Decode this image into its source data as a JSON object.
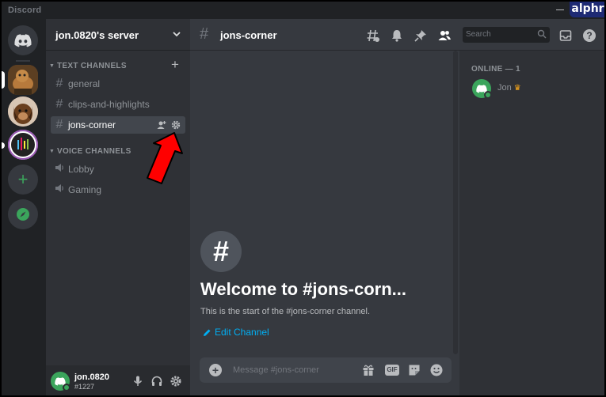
{
  "window": {
    "app_name": "Discord"
  },
  "watermark": "alphr",
  "server": {
    "name": "jon.0820's server"
  },
  "categories": {
    "text": "TEXT CHANNELS",
    "voice": "VOICE CHANNELS"
  },
  "text_channels": [
    {
      "name": "general"
    },
    {
      "name": "clips-and-highlights"
    },
    {
      "name": "jons-corner",
      "active": true
    }
  ],
  "voice_channels": [
    {
      "name": "Lobby"
    },
    {
      "name": "Gaming"
    }
  ],
  "user": {
    "name": "jon.0820",
    "tag": "#1227"
  },
  "topbar": {
    "channel": "jons-corner",
    "search_placeholder": "Search"
  },
  "welcome": {
    "title": "Welcome to #jons-corn...",
    "subtitle": "This is the start of the #jons-corner channel.",
    "edit_label": "Edit Channel"
  },
  "composer": {
    "placeholder": "Message #jons-corner",
    "gif_label": "GIF"
  },
  "members": {
    "header": "ONLINE — 1",
    "list": [
      {
        "name": "Jon",
        "owner": true
      }
    ]
  },
  "colors": {
    "accent_link": "#00aff4",
    "online": "#3ba55c",
    "annotation_arrow": "#ff0000"
  },
  "icons": {
    "rail": [
      "discord-home-icon",
      "server-icon",
      "add-server-icon",
      "explore-icon"
    ],
    "topbar": [
      "threads-icon",
      "bell-icon",
      "pin-icon",
      "members-icon",
      "inbox-icon",
      "help-icon"
    ],
    "composer": [
      "gift-icon",
      "gif-icon",
      "sticker-icon",
      "emoji-icon"
    ],
    "user": [
      "mic-icon",
      "headphones-icon",
      "settings-icon"
    ]
  }
}
